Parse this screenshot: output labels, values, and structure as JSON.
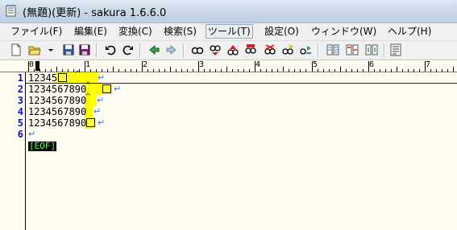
{
  "window": {
    "title": "(無題)(更新) - sakura 1.6.6.0"
  },
  "menu": [
    {
      "label": "ファイル(F)"
    },
    {
      "label": "編集(E)"
    },
    {
      "label": "変換(C)"
    },
    {
      "label": "検索(S)"
    },
    {
      "label": "ツール(T)",
      "active": true
    },
    {
      "label": "設定(O)"
    },
    {
      "label": "ウィンドウ(W)"
    },
    {
      "label": "ヘルプ(H)"
    }
  ],
  "toolbar_icons": [
    "new-file-icon",
    "open-folder-icon",
    "dropdown-arrow-icon",
    "save-icon",
    "save-all-icon",
    "undo-icon",
    "redo-icon",
    "jump-back-icon",
    "jump-forward-icon",
    "search-icon",
    "search-prev-icon",
    "search-next-icon",
    "search-box-icon",
    "replace-icon",
    "clear-mark-icon",
    "grep-icon",
    "outline-icon",
    "diff-icon",
    "compare-icon",
    "type-settings-icon"
  ],
  "ruler": {
    "labels": [
      "0",
      "1",
      "2",
      "3",
      "4",
      "5",
      "6",
      "7"
    ]
  },
  "editor": {
    "lines": [
      {
        "no": "1",
        "text": "12345"
      },
      {
        "no": "2",
        "text": "1234567890"
      },
      {
        "no": "3",
        "text": "1234567890"
      },
      {
        "no": "4",
        "text": "1234567890"
      },
      {
        "no": "5",
        "text": "1234567890"
      },
      {
        "no": "6",
        "text": ""
      }
    ],
    "eof": "[EOF]",
    "caret_char": "^",
    "return_char": "↵"
  },
  "colors": {
    "line_number": "#1010c8",
    "highlight": "#ffff00",
    "eof_text": "#60ff60"
  }
}
